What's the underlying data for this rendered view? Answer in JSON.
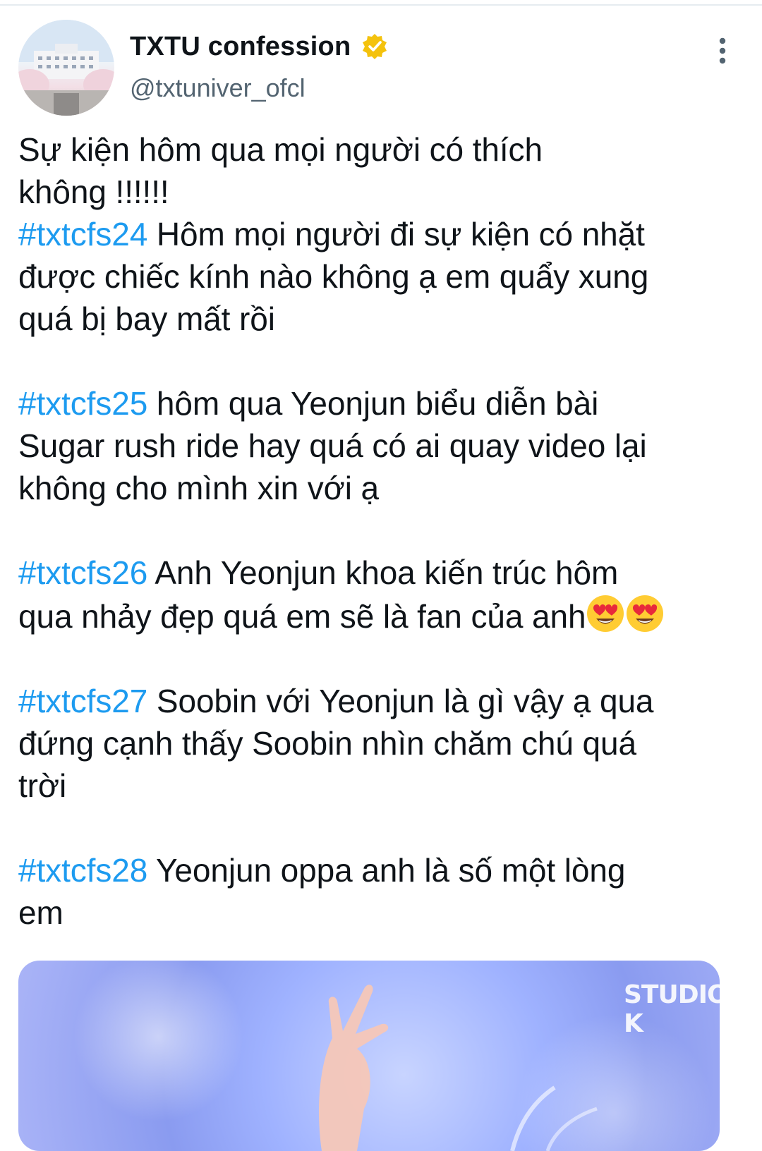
{
  "tweet": {
    "display_name": "TXTU confession",
    "handle": "@txtuniver_ofcl",
    "verified_icon": "verified-badge-icon",
    "menu_icon": "more-vertical-icon",
    "avatar_icon": "university-building-avatar",
    "lines": {
      "l1": "Sự kiện hôm qua mọi người có thích",
      "l2": "không !!!!!!",
      "tag24": "#txtcfs24",
      "l3": " Hôm mọi người đi sự kiện có nhặt",
      "l4": "được chiếc kính nào không ạ em quẩy xung",
      "l5": "quá bị bay mất rồi",
      "tag25": "#txtcfs25",
      "l6": " hôm qua Yeonjun biểu diễn bài",
      "l7": "Sugar rush ride hay quá có ai quay video lại",
      "l8": "không cho mình xin với ạ",
      "tag26": "#txtcfs26",
      "l9": " Anh Yeonjun khoa kiến trúc hôm",
      "l10": "qua nhảy đẹp quá em sẽ là fan của anh",
      "tag27": "#txtcfs27",
      "l11": " Soobin với Yeonjun là gì vậy ạ qua",
      "l12": "đứng cạnh thấy Soobin nhìn chăm chú quá",
      "l13": "trời",
      "tag28": "#txtcfs28",
      "l14": " Yeonjun oppa anh là số một lòng",
      "l15": "em"
    },
    "emoji": "heart-eyes-emoji",
    "media": {
      "watermark": "STUDIO K",
      "description_icon": "concert-photo-image"
    },
    "colors": {
      "hashtag": "#1d9bf0",
      "verified": "#f4c20d",
      "text": "#0f1419",
      "secondary": "#536471"
    }
  }
}
